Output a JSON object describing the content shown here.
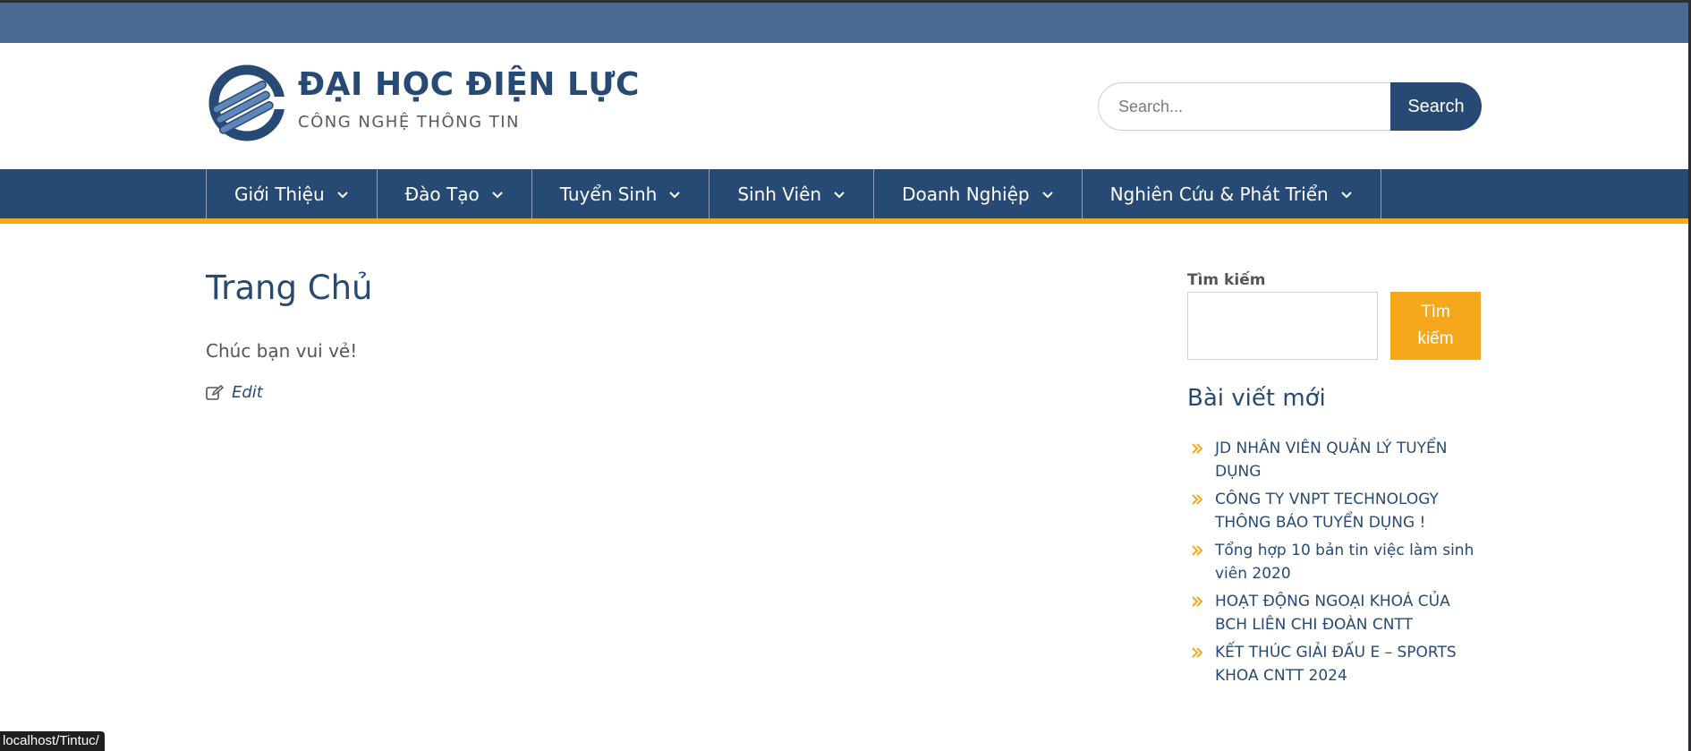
{
  "colors": {
    "primary": "#274a75",
    "topbar": "#4a6a93",
    "accent": "#f6a81c"
  },
  "header": {
    "logo_icon": "university-logo-icon",
    "title": "ĐẠI HỌC ĐIỆN LỰC",
    "tagline": "CÔNG NGHỆ THÔNG TIN",
    "search": {
      "placeholder": "Search...",
      "button_label": "Search"
    }
  },
  "nav": {
    "items": [
      {
        "label": "Giới Thiệu",
        "icon": "chevron-down-icon"
      },
      {
        "label": "Đào Tạo",
        "icon": "chevron-down-icon"
      },
      {
        "label": "Tuyển Sinh",
        "icon": "chevron-down-icon"
      },
      {
        "label": "Sinh Viên",
        "icon": "chevron-down-icon"
      },
      {
        "label": "Doanh Nghiệp",
        "icon": "chevron-down-icon"
      },
      {
        "label": "Nghiên Cứu & Phát Triển",
        "icon": "chevron-down-icon"
      }
    ]
  },
  "main": {
    "title": "Trang Chủ",
    "text": "Chúc bạn vui vẻ!",
    "edit_label": "Edit",
    "edit_icon": "edit-icon"
  },
  "sidebar": {
    "search_label": "Tìm kiếm",
    "search_button": "Tìm kiếm",
    "recent_heading": "Bài viết mới",
    "bullet_icon": "double-chevron-right-icon",
    "recent_posts": [
      "JD NHÂN VIÊN QUẢN LÝ TUYỂN DỤNG",
      "CÔNG TY VNPT TECHNOLOGY THÔNG BÁO TUYỂN DỤNG !",
      "Tổng hợp 10 bản tin việc làm sinh viên 2020",
      "HOẠT ĐỘNG NGOẠI KHOÁ CỦA BCH LIÊN CHI ĐOÀN CNTT",
      "KẾT THÚC GIẢI ĐẤU E – SPORTS KHOA CNTT 2024"
    ]
  },
  "status_bar": {
    "url": "localhost/Tintuc/"
  }
}
